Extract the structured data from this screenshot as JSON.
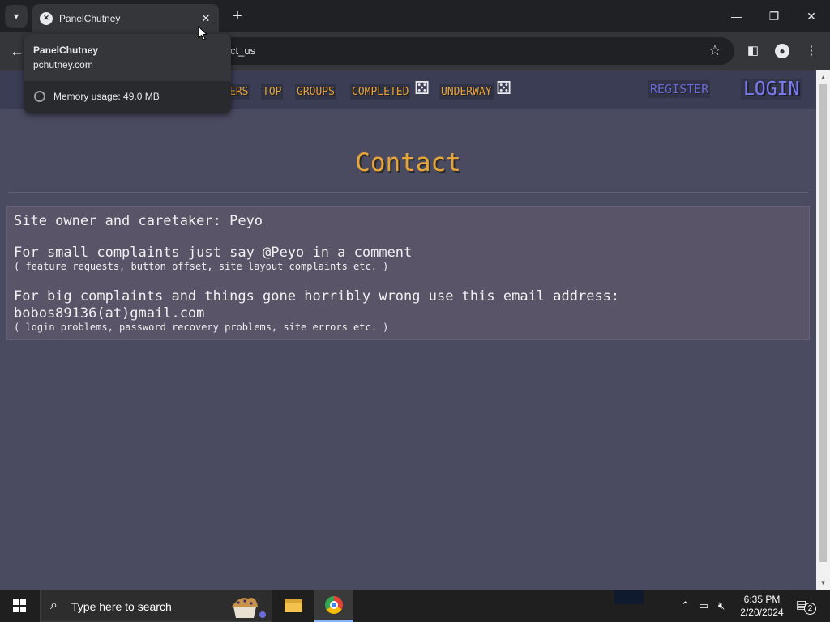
{
  "browser": {
    "tab_title": "PanelChutney",
    "tab_close": "✕",
    "new_tab": "+",
    "url_visible": "ct_us",
    "window_controls": {
      "minimize": "—",
      "restore": "❐",
      "close": "✕"
    },
    "hover_card": {
      "title": "PanelChutney",
      "domain": "pchutney.com",
      "memory": "Memory usage: 49.0 MB"
    }
  },
  "site_nav": {
    "links": [
      "ERS",
      "TOP",
      "GROUPS",
      "COMPLETED",
      "UNDERWAY"
    ],
    "register": "REGISTER",
    "login": "LOGIN"
  },
  "page": {
    "heading": "Contact",
    "owner_line": "Site owner and caretaker: Peyo",
    "small_complaints": "For small complaints just say @Peyo in a comment",
    "small_complaints_note": "( feature requests, button offset, site layout complaints etc. )",
    "big_complaints": "For big complaints and things gone horribly wrong use this email address:",
    "email": "bobos89136(at)gmail.com",
    "big_complaints_note": "( login problems, password recovery problems, site errors etc. )"
  },
  "taskbar": {
    "search_placeholder": "Type here to search",
    "time": "6:35 PM",
    "date": "2/20/2024",
    "notification_count": "2"
  },
  "colors": {
    "page_bg": "#4a4b61",
    "nav_link": "#e2a23c",
    "login": "#7b7bf0",
    "heading": "#e6a43b"
  }
}
